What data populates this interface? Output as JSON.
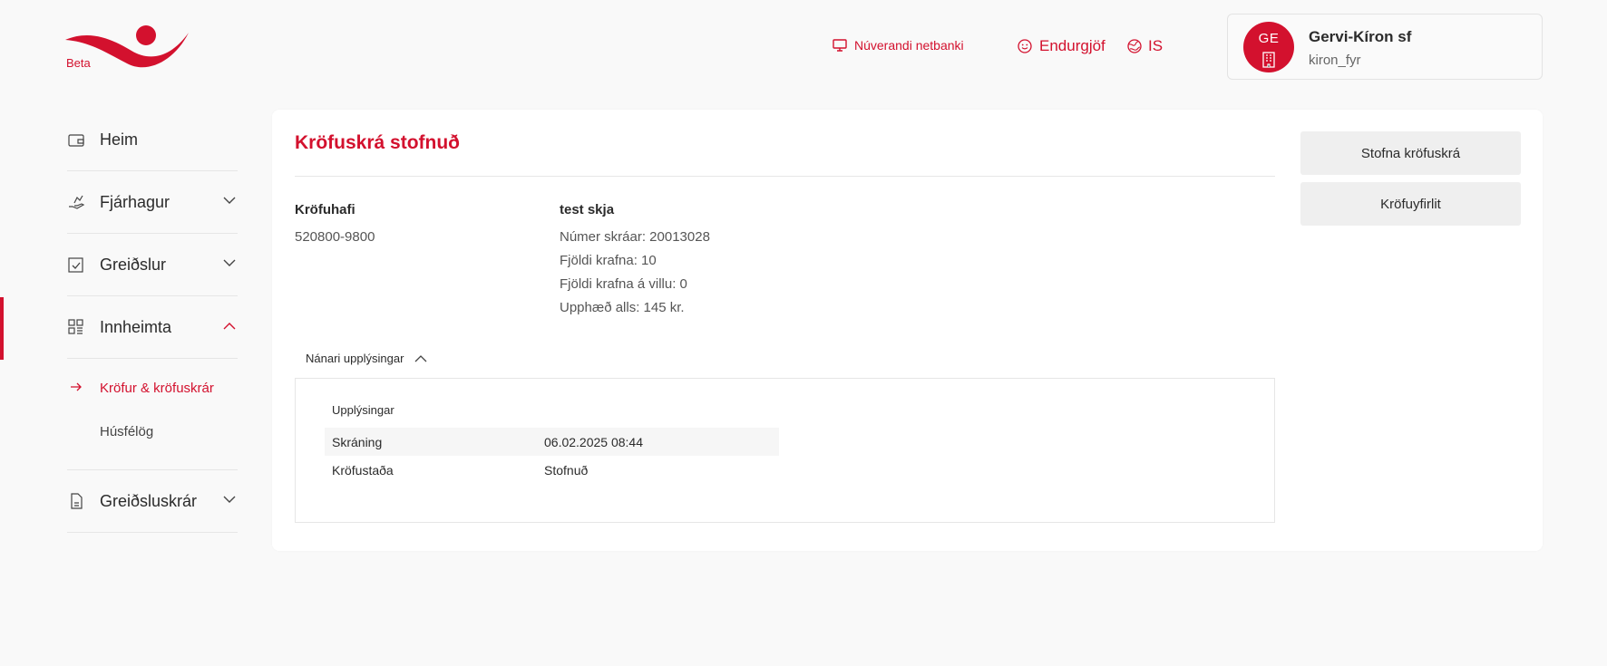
{
  "brand": {
    "beta_label": "Beta",
    "accent": "#d3112e"
  },
  "topbar": {
    "legacy_link": "Núverandi netbanki",
    "feedback_link": "Endurgjöf",
    "language": "IS"
  },
  "user": {
    "initials": "GE",
    "name": "Gervi-Kíron sf",
    "username": "kiron_fyr"
  },
  "sidebar": {
    "items": [
      {
        "label": "Heim",
        "icon": "wallet-icon"
      },
      {
        "label": "Fjárhagur",
        "icon": "hand-coins-icon"
      },
      {
        "label": "Greiðslur",
        "icon": "checkbox-icon"
      },
      {
        "label": "Innheimta",
        "icon": "grid-icon"
      },
      {
        "label": "Greiðsluskrár",
        "icon": "document-icon"
      }
    ],
    "sub_items": [
      {
        "label": "Kröfur & kröfuskrár"
      },
      {
        "label": "Húsfélög"
      }
    ]
  },
  "main": {
    "title": "Kröfuskrá stofnuð",
    "claimant_label": "Kröfuhafi",
    "claimant_id": "520800-9800",
    "file_name": "test skja",
    "file_number": "Númer skráar: 20013028",
    "claim_count": "Fjöldi krafna: 10",
    "error_count": "Fjöldi krafna á villu: 0",
    "total_amount": "Upphæð alls: 145 kr.",
    "details_toggle": "Nánari upplýsingar",
    "info_heading": "Upplýsingar",
    "info_rows": [
      {
        "key": "Skráning",
        "value": "06.02.2025 08:44"
      },
      {
        "key": "Kröfustaða",
        "value": "Stofnuð"
      }
    ]
  },
  "actions": {
    "create_file": "Stofna kröfuskrá",
    "overview": "Kröfuyfirlit"
  }
}
